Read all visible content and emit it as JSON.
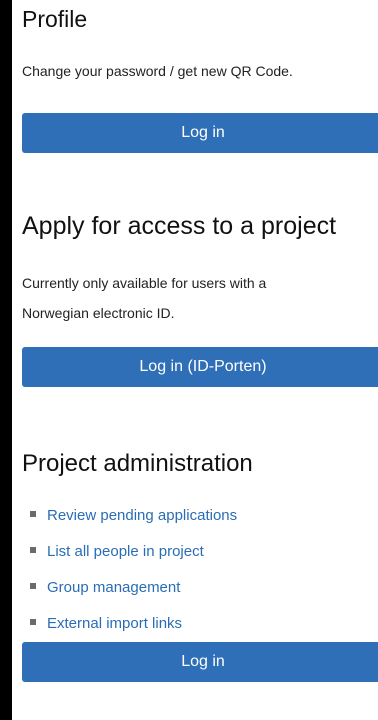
{
  "profile": {
    "title": "Profile",
    "description": "Change your password / get new QR Code.",
    "login_label": "Log in"
  },
  "apply": {
    "title": "Apply for access to a project",
    "description_line1": "Currently only available for users with a",
    "description_line2": "Norwegian electronic ID.",
    "login_label": "Log in (ID-Porten)"
  },
  "admin": {
    "title": "Project administration",
    "links": [
      {
        "label": "Review pending applications"
      },
      {
        "label": "List all people in project"
      },
      {
        "label": "Group management"
      },
      {
        "label": "External import links"
      }
    ],
    "login_label": "Log in"
  },
  "colors": {
    "button_background": "#2e6fb7",
    "link": "#2a6db5",
    "left_bar": "#000000"
  }
}
